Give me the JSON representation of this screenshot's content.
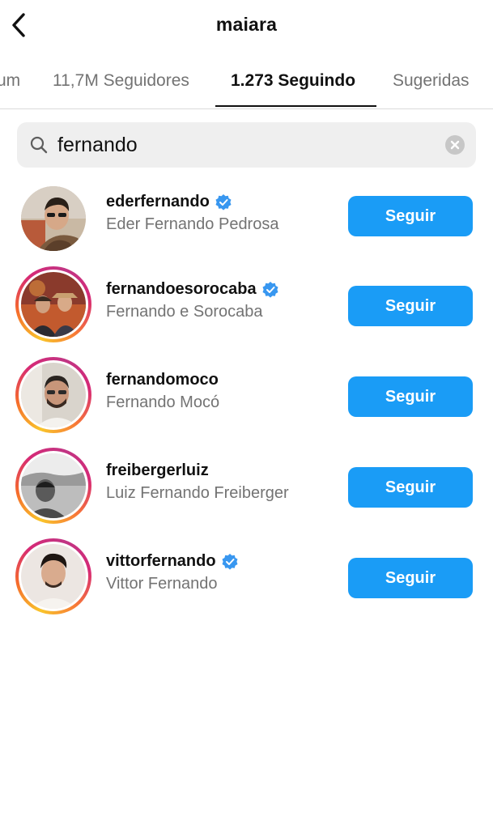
{
  "header": {
    "title": "maiara",
    "back_icon": "chevron-left-icon"
  },
  "tabs": [
    {
      "label": "um"
    },
    {
      "label": "11,7M Seguidores"
    },
    {
      "label": "1.273 Seguindo",
      "active": true
    },
    {
      "label": "Sugeridas"
    }
  ],
  "search": {
    "value": "fernando",
    "icon": "search-icon",
    "clear_icon": "clear-icon"
  },
  "accounts": [
    {
      "username": "ederfernando",
      "name": "Eder Fernando Pedrosa",
      "verified": true,
      "story_ring": false,
      "button": "Seguir"
    },
    {
      "username": "fernandoesorocaba",
      "name": "Fernando e Sorocaba",
      "verified": true,
      "story_ring": true,
      "button": "Seguir"
    },
    {
      "username": "fernandomoco",
      "name": "Fernando Mocó",
      "verified": false,
      "story_ring": true,
      "button": "Seguir"
    },
    {
      "username": "freibergerluiz",
      "name": "Luiz Fernando Freiberger",
      "verified": false,
      "story_ring": true,
      "button": "Seguir"
    },
    {
      "username": "vittorfernando",
      "name": "Vittor Fernando",
      "verified": true,
      "story_ring": true,
      "button": "Seguir"
    }
  ],
  "colors": {
    "accent": "#1a9cf6",
    "verified": "#3897f0",
    "secondary_text": "#737373"
  }
}
